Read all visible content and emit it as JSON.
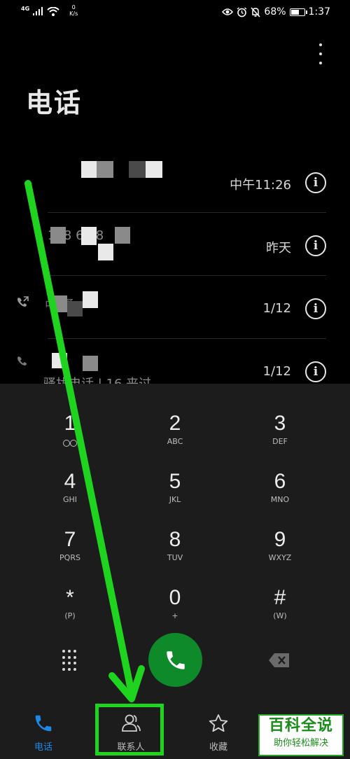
{
  "status_bar": {
    "network_type": "4G",
    "speed_value": "0",
    "speed_unit": "K/s",
    "battery_level": "68%",
    "battery_fraction": 0.68,
    "time": "1:37"
  },
  "page_title": "电话",
  "call_log": [
    {
      "time": "中午11:26",
      "call_type_icon": ""
    },
    {
      "time": "昨天",
      "call_type_icon": "",
      "partial_number": "188 6    68"
    },
    {
      "time": "1/12",
      "call_type_icon": "outgoing-call-icon",
      "partial_name": "中    通"
    },
    {
      "time": "1/12",
      "call_type_icon": "missed-call-icon",
      "partial_name": "骚扰电话 | 16    来过"
    }
  ],
  "dialpad": {
    "keys": [
      {
        "digit": "1",
        "letters": ""
      },
      {
        "digit": "2",
        "letters": "ABC"
      },
      {
        "digit": "3",
        "letters": "DEF"
      },
      {
        "digit": "4",
        "letters": "GHI"
      },
      {
        "digit": "5",
        "letters": "JKL"
      },
      {
        "digit": "6",
        "letters": "MNO"
      },
      {
        "digit": "7",
        "letters": "PQRS"
      },
      {
        "digit": "8",
        "letters": "TUV"
      },
      {
        "digit": "9",
        "letters": "WXYZ"
      },
      {
        "digit": "*",
        "letters": "(P)"
      },
      {
        "digit": "0",
        "letters": "+"
      },
      {
        "digit": "#",
        "letters": "(W)"
      }
    ]
  },
  "bottom_nav": {
    "phone": "电话",
    "contacts": "联系人",
    "favorites": "收藏"
  },
  "watermark": {
    "title": "百科全说",
    "subtitle": "助你轻松解决"
  },
  "colors": {
    "accent": "#1e88e5",
    "call_button": "#0f8a2a",
    "annotation": "#1fd41f"
  }
}
